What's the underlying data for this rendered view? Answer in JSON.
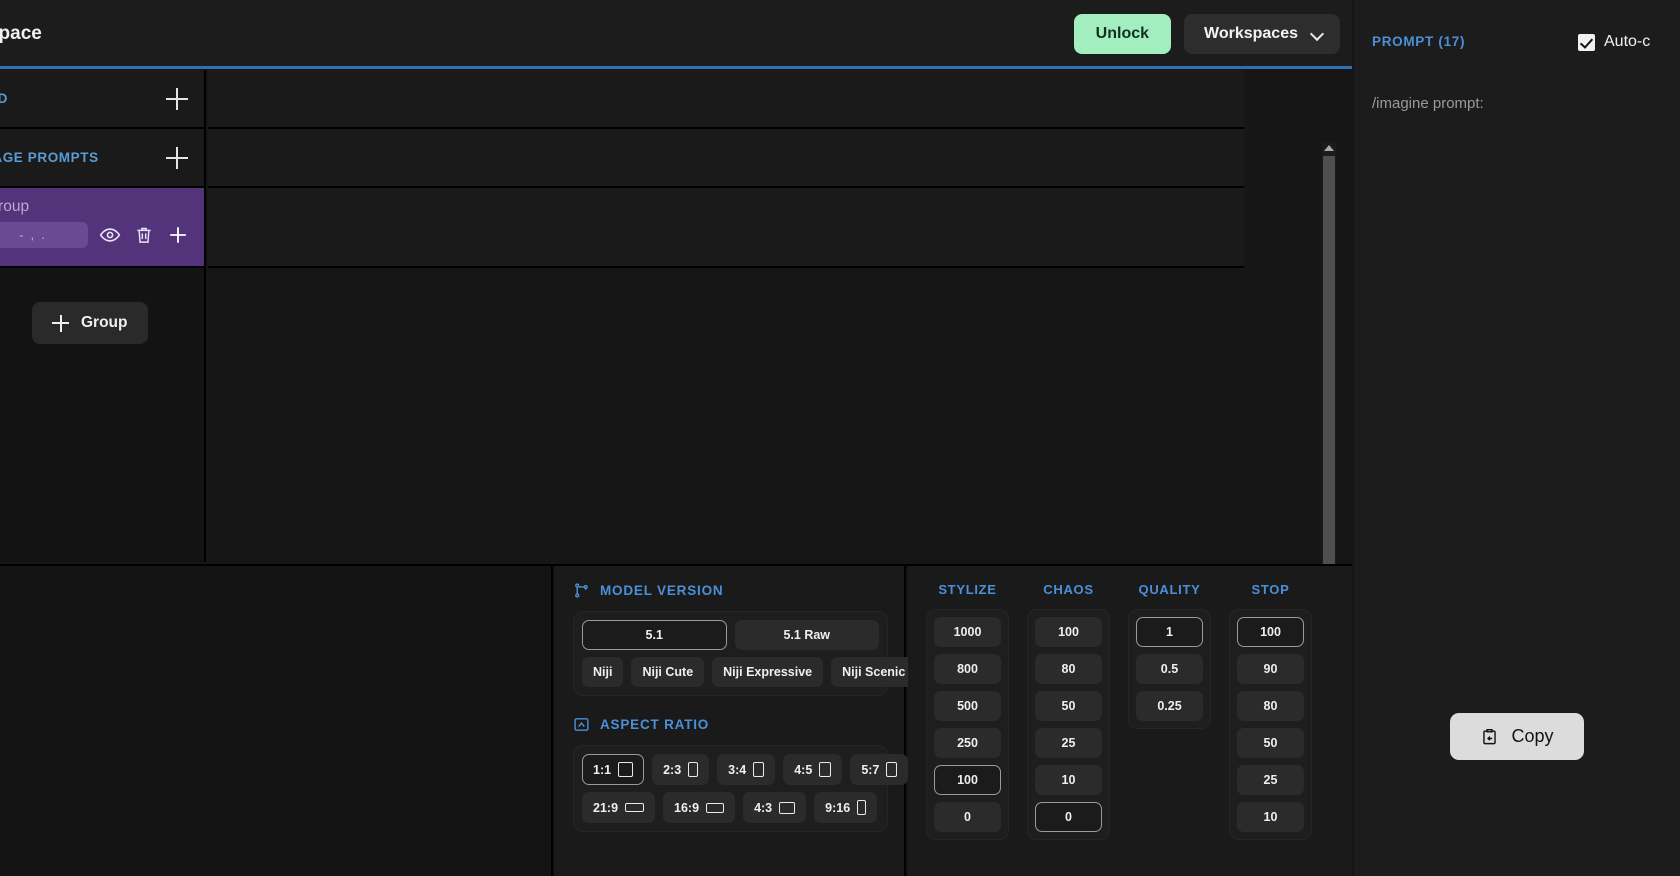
{
  "topbar": {
    "title": "rkspace",
    "unlock_label": "Unlock",
    "workspaces_label": "Workspaces",
    "chevron_icon": "chevron-down-icon",
    "accent_color": "#2f6fb5",
    "unlock_color": "#a3eebe"
  },
  "left_panel": {
    "rows": [
      {
        "label": "ED",
        "add_icon": "plus-icon"
      },
      {
        "label": "IAGE PROMPTS",
        "add_icon": "plus-icon"
      }
    ],
    "group": {
      "title": "Group",
      "pill_text": "-    ,     .",
      "eye_icon": "eye-icon",
      "trash_icon": "trash-icon",
      "plus_icon": "plus-icon",
      "background": "#53347a"
    },
    "add_group_label": "Group",
    "add_group_icon": "plus-icon"
  },
  "center": {
    "scrollbar": {
      "up_icon": "scroll-up-arrow-icon",
      "down_icon": "scroll-down-arrow-icon"
    }
  },
  "model_version": {
    "title": "MODEL VERSION",
    "icon": "branch-icon",
    "row1": [
      {
        "label": "5.1",
        "selected": true
      },
      {
        "label": "5.1 Raw",
        "selected": false
      }
    ],
    "row2": [
      {
        "label": "Niji",
        "selected": false
      },
      {
        "label": "Niji Cute",
        "selected": false
      },
      {
        "label": "Niji Expressive",
        "selected": false
      },
      {
        "label": "Niji Scenic",
        "selected": false
      }
    ]
  },
  "aspect_ratio": {
    "title": "ASPECT RATIO",
    "icon": "aspect-ratio-icon",
    "row1": [
      {
        "label": "1:1",
        "selected": true,
        "w": 15,
        "h": 15
      },
      {
        "label": "2:3",
        "selected": false,
        "w": 10,
        "h": 15
      },
      {
        "label": "3:4",
        "selected": false,
        "w": 11,
        "h": 15
      },
      {
        "label": "4:5",
        "selected": false,
        "w": 12,
        "h": 15
      },
      {
        "label": "5:7",
        "selected": false,
        "w": 11,
        "h": 15
      }
    ],
    "row2": [
      {
        "label": "21:9",
        "selected": false,
        "w": 19,
        "h": 9
      },
      {
        "label": "16:9",
        "selected": false,
        "w": 18,
        "h": 10
      },
      {
        "label": "4:3",
        "selected": false,
        "w": 16,
        "h": 12
      },
      {
        "label": "9:16",
        "selected": false,
        "w": 9,
        "h": 15
      }
    ]
  },
  "params": [
    {
      "title": "STYLIZE",
      "options": [
        {
          "label": "1000",
          "selected": false
        },
        {
          "label": "800",
          "selected": false
        },
        {
          "label": "500",
          "selected": false
        },
        {
          "label": "250",
          "selected": false
        },
        {
          "label": "100",
          "selected": true
        },
        {
          "label": "0",
          "selected": false
        }
      ]
    },
    {
      "title": "CHAOS",
      "options": [
        {
          "label": "100",
          "selected": false
        },
        {
          "label": "80",
          "selected": false
        },
        {
          "label": "50",
          "selected": false
        },
        {
          "label": "25",
          "selected": false
        },
        {
          "label": "10",
          "selected": false
        },
        {
          "label": "0",
          "selected": true
        }
      ]
    },
    {
      "title": "QUALITY",
      "options": [
        {
          "label": "1",
          "selected": true
        },
        {
          "label": "0.5",
          "selected": false
        },
        {
          "label": "0.25",
          "selected": false
        }
      ]
    },
    {
      "title": "STOP",
      "options": [
        {
          "label": "100",
          "selected": true
        },
        {
          "label": "90",
          "selected": false
        },
        {
          "label": "80",
          "selected": false
        },
        {
          "label": "50",
          "selected": false
        },
        {
          "label": "25",
          "selected": false
        },
        {
          "label": "10",
          "selected": false
        }
      ]
    }
  ],
  "prompt_panel": {
    "title": "PROMPT (17)",
    "autocopy_label": "Auto-c",
    "autocopy_checked": true,
    "prompt_text": "/imagine prompt:",
    "copy_label": "Copy",
    "copy_icon": "clipboard-copy-icon"
  }
}
